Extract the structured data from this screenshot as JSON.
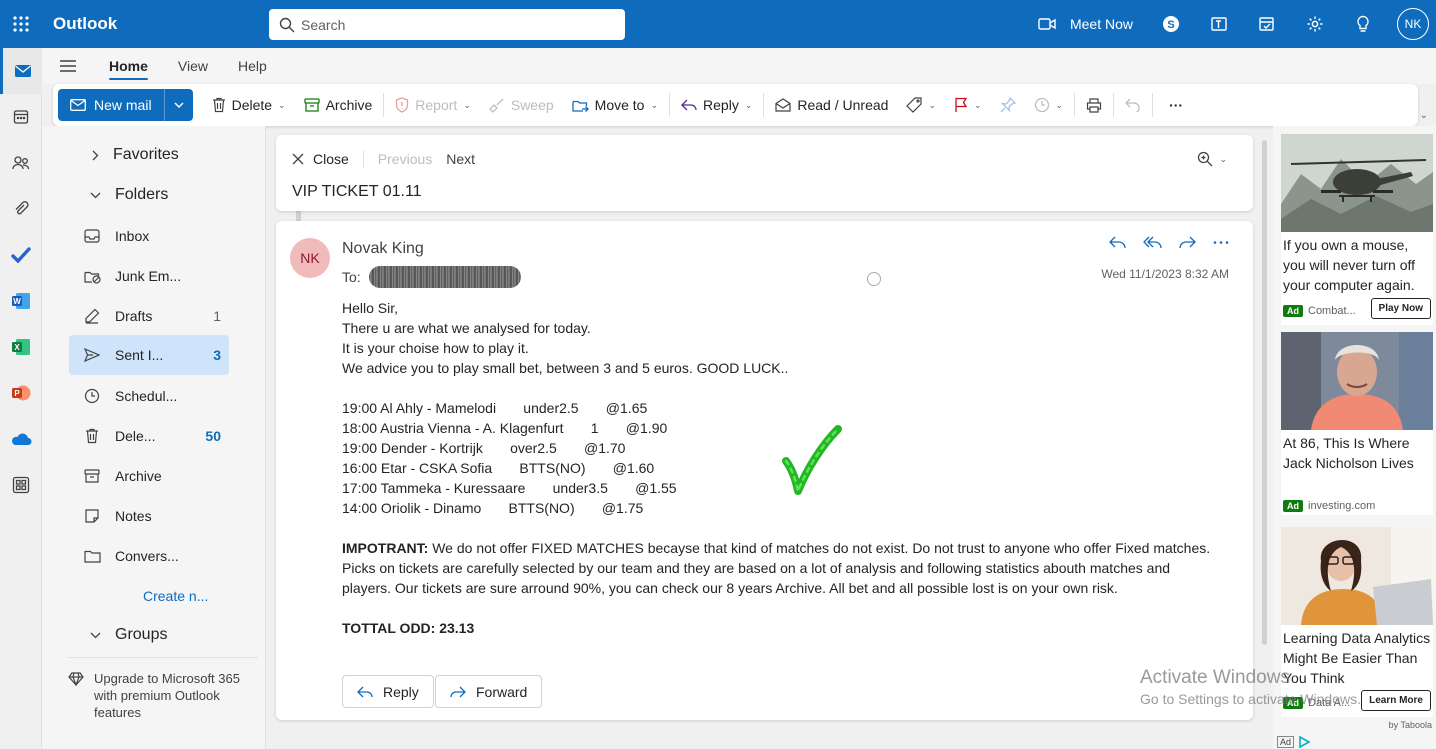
{
  "app": {
    "name": "Outlook",
    "search_placeholder": "Search",
    "meet_now": "Meet Now",
    "user_initials": "NK"
  },
  "tabs": [
    {
      "label": "Home"
    },
    {
      "label": "View"
    },
    {
      "label": "Help"
    }
  ],
  "ribbon": {
    "new_mail": "New mail",
    "delete": "Delete",
    "archive": "Archive",
    "report": "Report",
    "sweep": "Sweep",
    "move_to": "Move to",
    "reply": "Reply",
    "read_unread": "Read / Unread",
    "more": "···"
  },
  "nav": {
    "favorites": "Favorites",
    "folders": "Folders",
    "groups": "Groups",
    "create_new": "Create n...",
    "items": [
      {
        "label": "Inbox",
        "count": ""
      },
      {
        "label": "Junk Em...",
        "count": ""
      },
      {
        "label": "Drafts",
        "count": "1"
      },
      {
        "label": "Sent I...",
        "count": "3"
      },
      {
        "label": "Schedul...",
        "count": ""
      },
      {
        "label": "Dele...",
        "count": "50"
      },
      {
        "label": "Archive",
        "count": ""
      },
      {
        "label": "Notes",
        "count": ""
      },
      {
        "label": "Convers...",
        "count": ""
      }
    ],
    "upgrade": "Upgrade to Microsoft 365 with premium Outlook features"
  },
  "reading": {
    "close": "Close",
    "previous": "Previous",
    "next": "Next",
    "subject": "VIP TICKET 01.11"
  },
  "message": {
    "initials": "NK",
    "sender": "Novak King",
    "to_label": "To:",
    "date": "Wed 11/1/2023 8:32 AM",
    "lines": [
      "Hello Sir,",
      "There u are what we analysed for today.",
      "It is your choise how to play it.",
      "We advice you to play small bet, between 3 and 5 euros. GOOD LUCK..",
      "",
      "19:00 Al Ahly - Mamelodi       under2.5       @1.65",
      "18:00 Austria Vienna - A. Klagenfurt       1       @1.90",
      "19:00 Dender - Kortrijk       over2.5       @1.70",
      "16:00 Etar - CSKA Sofia       BTTS(NO)       @1.60",
      "17:00 Tammeka - Kuressaare       under3.5       @1.55",
      "14:00 Oriolik - Dinamo       BTTS(NO)       @1.75",
      ""
    ],
    "important_label": "IMPOTRANT:",
    "important_text": " We do not offer FIXED MATCHES becayse that kind of matches do not exist. Do not trust to anyone who offer Fixed matches. Picks on tickets are carefully selected by our team and they are based on a lot of analysis and following statistics abouth matches and players. Our tickets are sure arround 90%, you can check our 8 years Archive. All bet and all possible lost is on your own risk.",
    "total": "TOTTAL ODD: 23.13",
    "reply": "Reply",
    "forward": "Forward"
  },
  "ads": [
    {
      "title": "If you own a mouse, you will never turn off your computer again.",
      "tag": "Ad",
      "source": "Combat...",
      "button": "Play Now"
    },
    {
      "title": "At 86, This Is Where Jack Nicholson Lives",
      "tag": "Ad",
      "source": "investing.com",
      "button": ""
    },
    {
      "title": "Learning Data Analytics Might Be Easier Than You Think",
      "tag": "Ad",
      "source": "Data A...",
      "button": "Learn More"
    }
  ],
  "ad_footer": {
    "by": "by Taboola",
    "ad": "Ad"
  },
  "watermark": {
    "title": "Activate Windows",
    "subtitle": "Go to Settings to activate Windows."
  },
  "colors": {
    "brand": "#0f6cbd",
    "selected_folder": "#cfe4fa",
    "check": "#22b822"
  }
}
